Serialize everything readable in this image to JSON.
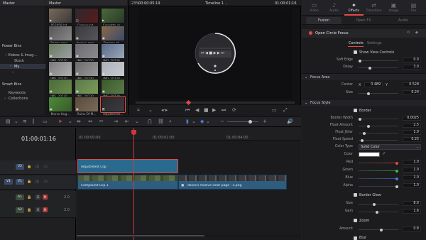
{
  "colors": {
    "accent": "#e24a43",
    "adjustment_clip": "#2b6a8f",
    "video_clip": "#2e5d80",
    "playhead": "#d0383a"
  },
  "bins": {
    "master_label": "Master",
    "power_bins_title": "Power Bins",
    "power_items": [
      "Videos & Imag...",
      "Stock",
      "My"
    ],
    "smart_bins_title": "Smart Bins",
    "smart_items": [
      "Keywords",
      "Collections"
    ]
  },
  "pool": {
    "header": "Master",
    "clips": [
      {
        "name": "853958-hd...",
        "icon": "video-icon"
      },
      {
        "name": "Compound...",
        "icon": "compound-icon"
      },
      {
        "name": "Corvette_ra...",
        "icon": "video-icon"
      },
      {
        "name": "Baimo reso...",
        "icon": "image-icon"
      },
      {
        "name": "davinci reso...",
        "icon": "image-icon"
      },
      {
        "name": "Dreams of ...",
        "icon": "image-icon"
      },
      {
        "name": "IMG_20230...",
        "icon": "image-icon"
      },
      {
        "name": "IMG_20230...",
        "icon": "image-icon"
      },
      {
        "name": "IMG_20230...",
        "icon": "image-icon"
      },
      {
        "name": "IMG_20230...",
        "icon": "image-icon"
      },
      {
        "name": "IMG_20230...",
        "icon": "image-icon"
      },
      {
        "name": "IMG_20230...",
        "icon": "image-icon"
      },
      {
        "name": "IMG_20230...",
        "icon": "image-icon"
      },
      {
        "name": "IMG_20230...",
        "icon": "image-icon"
      },
      {
        "name": "IMG_20230...",
        "icon": "image-icon"
      },
      {
        "name": "Marco Hug...",
        "icon": "image-icon"
      },
      {
        "name": "Ruins Of M...",
        "icon": "image-icon"
      },
      {
        "name": "Adjustment...",
        "icon": "adjustment-icon"
      }
    ]
  },
  "viewer": {
    "zoom": "23%",
    "tc_left": "00:00:05:19",
    "timeline_name": "Timeline 1",
    "tc_right": "01:00:01:16"
  },
  "inspector": {
    "tabs": [
      {
        "label": "Video",
        "icon": "▭"
      },
      {
        "label": "Audio",
        "icon": "♪"
      },
      {
        "label": "Effects",
        "icon": "✦"
      },
      {
        "label": "Transition",
        "icon": "⇄"
      },
      {
        "label": "Image",
        "icon": "▣"
      },
      {
        "label": "File",
        "icon": "▤"
      }
    ],
    "subtabs": [
      "Fusion",
      "Open FX",
      "Audio"
    ],
    "effect_name": "Open Circle Focus",
    "ctrl_tabs": [
      "Controls",
      "Settings"
    ],
    "show_view_controls": "Show View Controls",
    "soft_edge_label": "Soft Edge",
    "soft_edge": "0.0",
    "delay_label": "Delay",
    "delay": "3.0",
    "focus_area": "Focus Area",
    "center_label": "Center",
    "center_x_label": "X",
    "center_x": "0.489",
    "center_y_label": "Y",
    "center_y": "0.528",
    "size_label": "Size",
    "size": "0.24",
    "focus_style": "Focus Style",
    "border_label": "Border",
    "border_width_label": "Border Width",
    "border_width": "0.0025",
    "float_amount_label": "Float Amount",
    "float_amount": "2.5",
    "float_jitter_label": "Float Jitter",
    "float_jitter": "1.0",
    "float_speed_label": "Float Speed",
    "float_speed": "0.25",
    "color_type_label": "Color Type",
    "color_type": "Solid Color",
    "color_label": "Color",
    "red_label": "Red",
    "red": "1.0",
    "green_label": "Green",
    "green": "1.0",
    "blue_label": "Blue",
    "blue": "1.0",
    "alpha_label": "Alpha",
    "alpha": "1.0",
    "border_glow_label": "Border Glow",
    "glow_size_label": "Size",
    "glow_size": "8.0",
    "gain_label": "Gain",
    "gain": "1.6",
    "zoom_label": "Zoom",
    "amount_label": "Amount",
    "amount": "0.8",
    "blur_label": "Blur"
  },
  "timeline": {
    "timecode": "01:00:01:16",
    "ruler": [
      "01:00:00:00",
      "01:00:02:00",
      "01:00:04:00"
    ],
    "tracks": [
      {
        "id": "V2",
        "kind": "video"
      },
      {
        "id": "V1",
        "kind": "video"
      },
      {
        "id": "A1",
        "kind": "audio",
        "level": "2.0"
      },
      {
        "id": "A2",
        "kind": "audio",
        "level": "2.0"
      }
    ],
    "clips": {
      "adjustment": "Adjustment Clip",
      "compound": "Compound Clip 1",
      "image": "davinci resolve color page - 2.png"
    }
  }
}
